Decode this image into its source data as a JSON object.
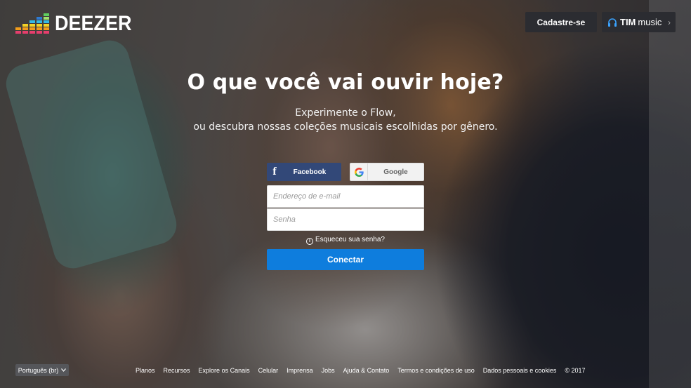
{
  "header": {
    "logo_text": "DEEZER",
    "signup_label": "Cadastre-se",
    "partner": {
      "brand": "TIM",
      "label": "music"
    }
  },
  "hero": {
    "headline": "O que você vai ouvir hoje?",
    "sub_line1": "Experimente o Flow,",
    "sub_line2": "ou descubra nossas coleções musicais escolhidas por gênero."
  },
  "login": {
    "facebook_label": "Facebook",
    "google_label": "Google",
    "email_placeholder": "Endereço de e-mail",
    "password_placeholder": "Senha",
    "forgot_label": "Esqueceu sua senha?",
    "connect_label": "Conectar"
  },
  "footer": {
    "language": "Português (br)",
    "links": [
      "Planos",
      "Recursos",
      "Explore os Canais",
      "Celular",
      "Imprensa",
      "Jobs",
      "Ajuda & Contato",
      "Termos e condições de uso",
      "Dados pessoais e cookies",
      "© 2017"
    ]
  },
  "icons": {
    "facebook": "facebook-icon",
    "google": "google-icon",
    "headphones": "headphones-icon",
    "info": "info-icon",
    "chevron": "chevron-right-icon"
  },
  "colors": {
    "connect_button": "#0e7ddd",
    "facebook_button": "#324878",
    "header_button": "#2b2c31"
  }
}
